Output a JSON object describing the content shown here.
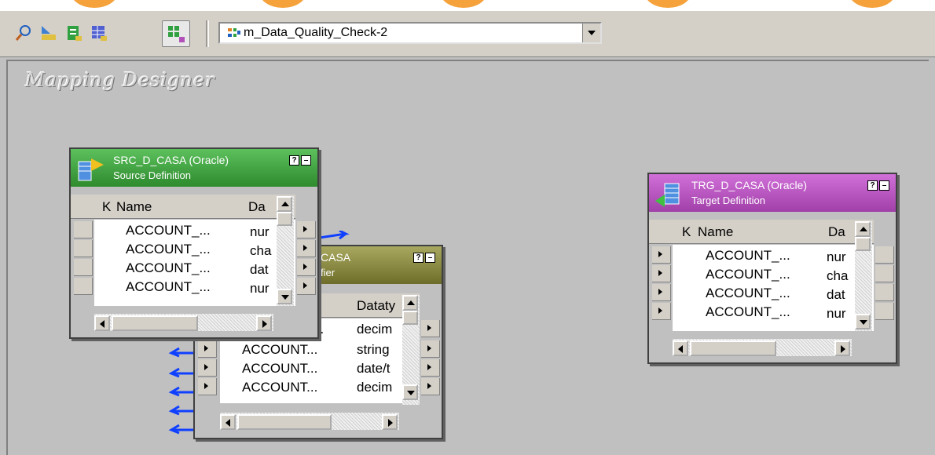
{
  "toolbar": {
    "icons": [
      "source-analyzer-icon",
      "target-designer-icon",
      "transformation-developer-icon",
      "mapplet-designer-icon",
      "mapping-designer-icon"
    ],
    "mapping_select": {
      "value": "m_Data_Quality_Check-2"
    }
  },
  "canvas": {
    "title": "Mapping Designer"
  },
  "source": {
    "title": "SRC_D_CASA (Oracle)",
    "subtitle": "Source Definition",
    "color": "#3aa53a",
    "columns": [
      "K",
      "Name",
      "Da"
    ],
    "rows": [
      {
        "name": "ACCOUNT_...",
        "type": "nur"
      },
      {
        "name": "ACCOUNT_...",
        "type": "cha"
      },
      {
        "name": "ACCOUNT_...",
        "type": "dat"
      },
      {
        "name": "ACCOUNT_...",
        "type": "nur"
      }
    ]
  },
  "qualifier": {
    "title_partial": "CASA",
    "subtitle_partial": "fier",
    "color": "#8a8a3a",
    "columns": [
      "Dataty"
    ],
    "rows": [
      {
        "name": "...",
        "type": "decim"
      },
      {
        "name": "ACCOUNT...",
        "type": "string"
      },
      {
        "name": "ACCOUNT...",
        "type": "date/t"
      },
      {
        "name": "ACCOUNT...",
        "type": "decim"
      }
    ]
  },
  "target": {
    "title": "TRG_D_CASA (Oracle)",
    "subtitle": "Target Definition",
    "color": "#b050b8",
    "columns": [
      "K",
      "Name",
      "Da"
    ],
    "rows": [
      {
        "name": "ACCOUNT_...",
        "type": "nur"
      },
      {
        "name": "ACCOUNT_...",
        "type": "cha"
      },
      {
        "name": "ACCOUNT_...",
        "type": "dat"
      },
      {
        "name": "ACCOUNT_...",
        "type": "nur"
      }
    ]
  },
  "header_buttons": {
    "help": "?",
    "minimize": "–"
  }
}
